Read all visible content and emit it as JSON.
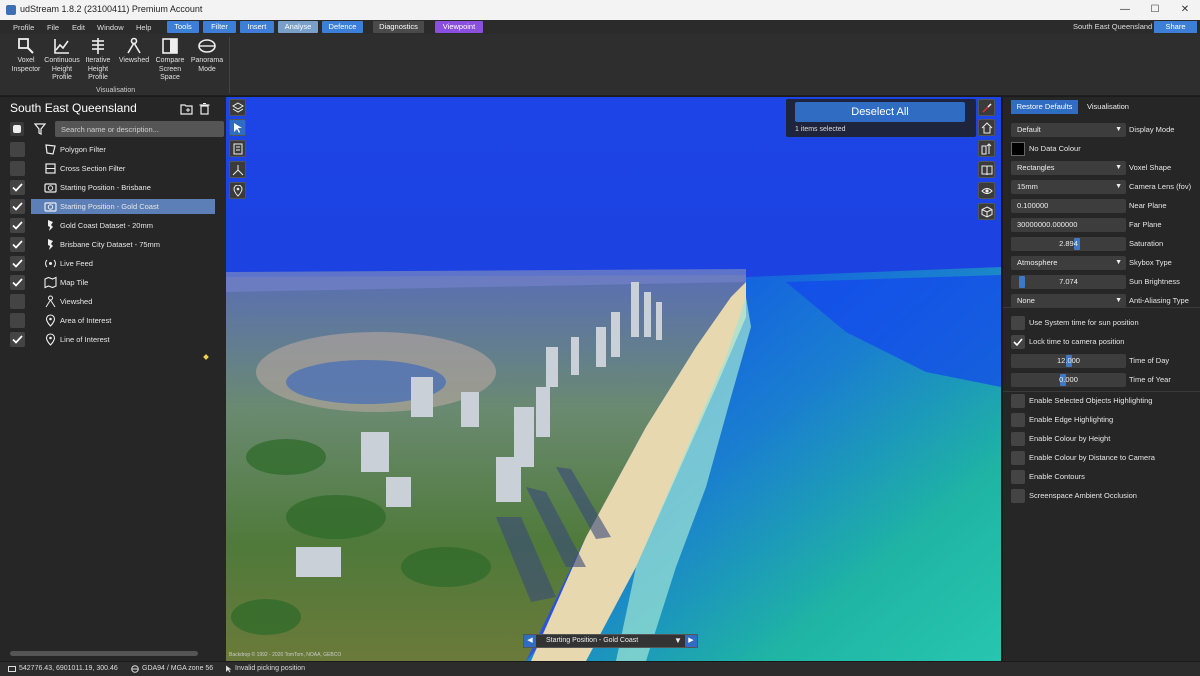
{
  "window": {
    "title": "udStream 1.8.2 (23100411) Premium Account",
    "minimize": "—",
    "maximize": "☐",
    "close": "✕"
  },
  "menu": {
    "items": [
      "Profile",
      "File",
      "Edit",
      "Window",
      "Help"
    ],
    "tabs": [
      {
        "label": "Tools",
        "color": "#3d7fd6"
      },
      {
        "label": "Filter",
        "color": "#3d7fd6"
      },
      {
        "label": "Insert",
        "color": "#3d7fd6"
      },
      {
        "label": "Analyse",
        "color": "#7a9fc9"
      },
      {
        "label": "Defence",
        "color": "#3d7fd6"
      },
      {
        "label": "Diagnostics",
        "color": "#4a4a4a"
      },
      {
        "label": "Viewpoint",
        "color": "#8b4fe0"
      }
    ],
    "region": "South East Queensland",
    "share": "Share Scene"
  },
  "ribbon": {
    "buttons": [
      {
        "label": "Voxel Inspector",
        "icon": "voxel-inspector-icon"
      },
      {
        "label": "Continuous Height Profile",
        "icon": "height-profile-icon"
      },
      {
        "label": "Iterative Height Profile",
        "icon": "iterative-profile-icon"
      },
      {
        "label": "Viewshed",
        "icon": "viewshed-icon"
      },
      {
        "label": "Compare Screen Space",
        "icon": "compare-icon"
      },
      {
        "label": "Panorama Mode",
        "icon": "panorama-icon"
      }
    ],
    "group": "Visualisation"
  },
  "scene": {
    "title": "South East Queensland",
    "search_placeholder": "Search name or description...",
    "items": [
      {
        "label": "Polygon Filter",
        "checked": false,
        "selected": false,
        "icon": "polygon-filter-icon"
      },
      {
        "label": "Cross Section Filter",
        "checked": false,
        "selected": false,
        "icon": "cross-section-icon"
      },
      {
        "label": "Starting Position - Brisbane",
        "checked": true,
        "selected": false,
        "icon": "camera-icon"
      },
      {
        "label": "Starting Position - Gold Coast",
        "checked": true,
        "selected": true,
        "icon": "camera-icon"
      },
      {
        "label": "Gold Coast Dataset - 20mm",
        "checked": true,
        "selected": false,
        "icon": "dataset-icon"
      },
      {
        "label": "Brisbane City Dataset - 75mm",
        "checked": true,
        "selected": false,
        "icon": "dataset-icon"
      },
      {
        "label": "Live Feed",
        "checked": true,
        "selected": false,
        "icon": "live-feed-icon"
      },
      {
        "label": "Map Tile",
        "checked": true,
        "selected": false,
        "icon": "map-tile-icon"
      },
      {
        "label": "Viewshed",
        "checked": false,
        "selected": false,
        "icon": "viewshed-icon"
      },
      {
        "label": "Area of Interest",
        "checked": false,
        "selected": false,
        "icon": "pin-icon"
      },
      {
        "label": "Line of Interest",
        "checked": true,
        "selected": false,
        "icon": "pin-icon"
      }
    ]
  },
  "viewport": {
    "deselect": "Deselect All",
    "selected_count": "1 items selected",
    "attribution": "Backdrop © 1992 - 2020 TomTom, NOAA, GEBCO",
    "viewpoint": "Starting Position - Gold Coast",
    "prev": "◀",
    "next": "▶",
    "caret": "▼"
  },
  "settings": {
    "restore": "Restore Defaults",
    "tab": "Visualisation",
    "display_mode": {
      "value": "Default",
      "label": "Display Mode"
    },
    "no_data": "No Data Colour",
    "voxel_shape": {
      "value": "Rectangles",
      "label": "Voxel Shape"
    },
    "camera_lens": {
      "value": "15mm",
      "label": "Camera Lens (fov)"
    },
    "near_plane": {
      "value": "0.100000",
      "label": "Near Plane"
    },
    "far_plane": {
      "value": "30000000.000000",
      "label": "Far Plane"
    },
    "saturation": {
      "value": "2.894",
      "label": "Saturation",
      "level": 0.58
    },
    "skybox": {
      "value": "Atmosphere",
      "label": "Skybox Type"
    },
    "sun_brightness": {
      "value": "7.074",
      "label": "Sun Brightness",
      "level": 0.07
    },
    "antialiasing": {
      "value": "None",
      "label": "Anti-Aliasing Type"
    },
    "system_time": {
      "label": "Use System time for sun position",
      "checked": false
    },
    "lock_time": {
      "label": "Lock time to camera position",
      "checked": true
    },
    "time_of_day": {
      "value": "12.000",
      "label": "Time of Day",
      "level": 0.5
    },
    "time_of_year": {
      "value": "0.000",
      "label": "Time of Year",
      "level": 0.45
    },
    "toggles": [
      {
        "label": "Enable Selected Objects Highlighting",
        "checked": false
      },
      {
        "label": "Enable Edge Highlighting",
        "checked": false
      },
      {
        "label": "Enable Colour by Height",
        "checked": false
      },
      {
        "label": "Enable Colour by Distance to Camera",
        "checked": false
      },
      {
        "label": "Enable Contours",
        "checked": false
      },
      {
        "label": "Screenspace Ambient Occlusion",
        "checked": false
      }
    ]
  },
  "status": {
    "coords": "542776.43, 6901011.19, 300.46",
    "zone": "GDA94 / MGA zone 56",
    "picking": "Invalid picking position"
  }
}
